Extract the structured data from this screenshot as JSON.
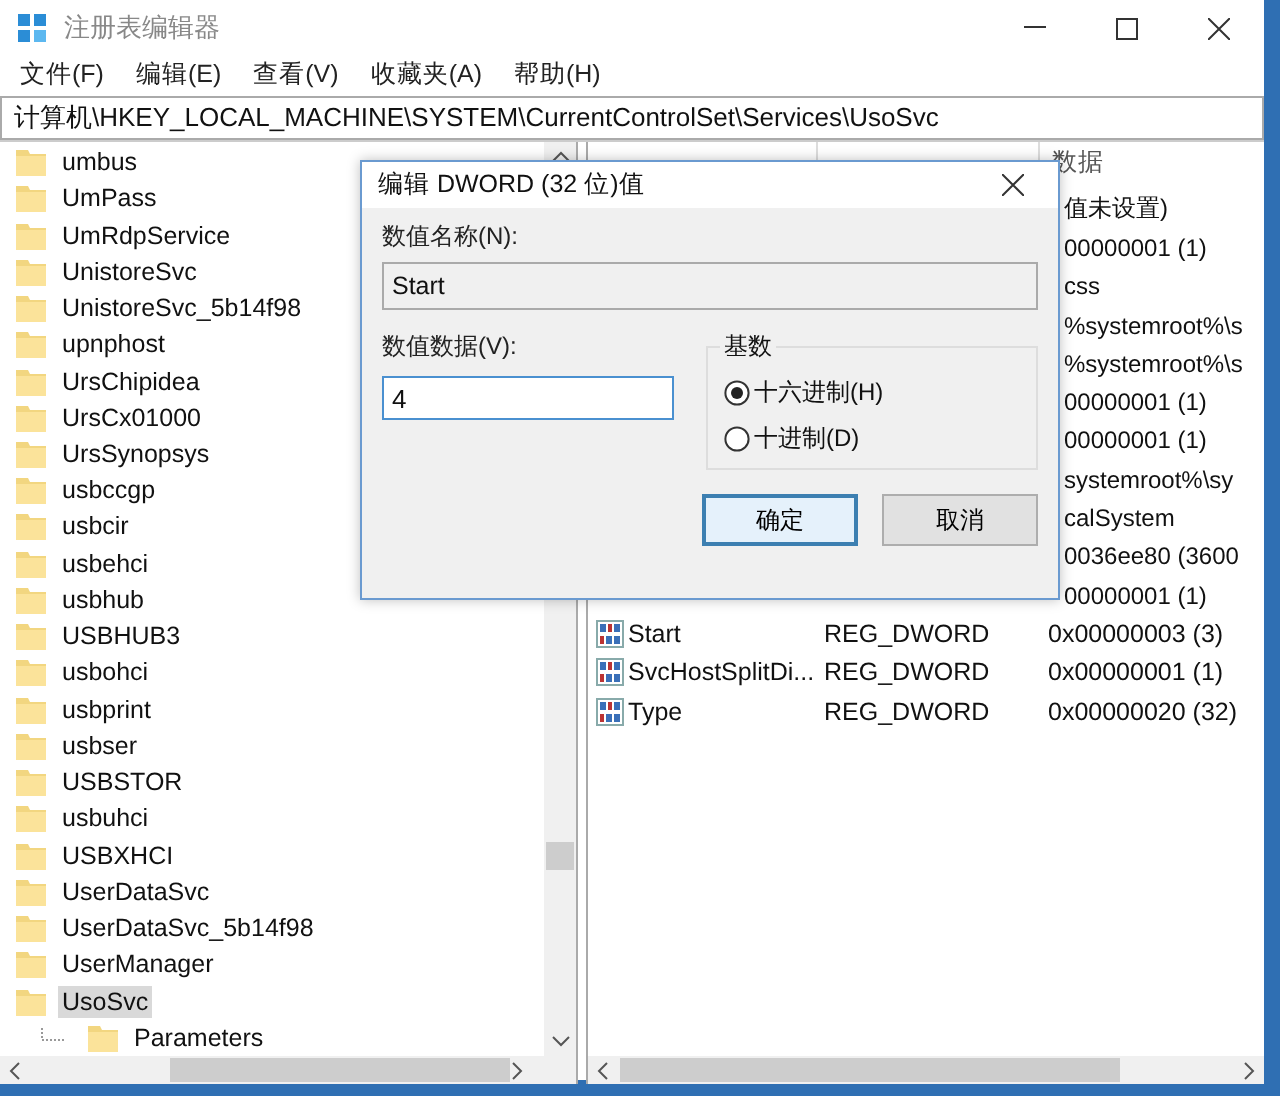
{
  "window": {
    "title": "注册表编辑器"
  },
  "menu": [
    {
      "label": "文件(F)"
    },
    {
      "label": "编辑(E)"
    },
    {
      "label": "查看(V)"
    },
    {
      "label": "收藏夹(A)"
    },
    {
      "label": "帮助(H)"
    }
  ],
  "address": "计算机\\HKEY_LOCAL_MACHINE\\SYSTEM\\CurrentControlSet\\Services\\UsoSvc",
  "tree": [
    {
      "label": "umbus",
      "selected": false
    },
    {
      "label": "UmPass",
      "selected": false
    },
    {
      "label": "UmRdpService",
      "selected": false
    },
    {
      "label": "UnistoreSvc",
      "selected": false
    },
    {
      "label": "UnistoreSvc_5b14f98",
      "selected": false
    },
    {
      "label": "upnphost",
      "selected": false
    },
    {
      "label": "UrsChipidea",
      "selected": false
    },
    {
      "label": "UrsCx01000",
      "selected": false
    },
    {
      "label": "UrsSynopsys",
      "selected": false
    },
    {
      "label": "usbccgp",
      "selected": false
    },
    {
      "label": "usbcir",
      "selected": false
    },
    {
      "label": "usbehci",
      "selected": false
    },
    {
      "label": "usbhub",
      "selected": false
    },
    {
      "label": "USBHUB3",
      "selected": false
    },
    {
      "label": "usbohci",
      "selected": false
    },
    {
      "label": "usbprint",
      "selected": false
    },
    {
      "label": "usbser",
      "selected": false
    },
    {
      "label": "USBSTOR",
      "selected": false
    },
    {
      "label": "usbuhci",
      "selected": false
    },
    {
      "label": "USBXHCI",
      "selected": false
    },
    {
      "label": "UserDataSvc",
      "selected": false
    },
    {
      "label": "UserDataSvc_5b14f98",
      "selected": false
    },
    {
      "label": "UserManager",
      "selected": false
    },
    {
      "label": "UsoSvc",
      "selected": true,
      "children": [
        {
          "label": "Parameters",
          "selected": false
        }
      ]
    }
  ],
  "values": {
    "data_header": "数据",
    "rows": [
      {
        "data": "值未设置)"
      },
      {
        "data": "00000001 (1)"
      },
      {
        "data": "css"
      },
      {
        "data": "%systemroot%\\s"
      },
      {
        "data": "%systemroot%\\s"
      },
      {
        "data": "00000001 (1)"
      },
      {
        "data": "00000001 (1)"
      },
      {
        "data": "systemroot%\\sy"
      },
      {
        "data": "calSystem"
      },
      {
        "data": "0036ee80 (3600"
      },
      {
        "data": "00000001 (1)"
      },
      {
        "name": "Start",
        "type": "REG_DWORD",
        "data": "0x00000003 (3)"
      },
      {
        "name": "SvcHostSplitDi...",
        "type": "REG_DWORD",
        "data": "0x00000001 (1)"
      },
      {
        "name": "Type",
        "type": "REG_DWORD",
        "data": "0x00000020 (32)"
      }
    ]
  },
  "dialog": {
    "title": "编辑 DWORD (32 位)值",
    "name_label": "数值名称(N):",
    "name_value": "Start",
    "data_label": "数值数据(V):",
    "data_value": "4",
    "base_label": "基数",
    "bases": [
      {
        "label": "十六进制(H)",
        "selected": true
      },
      {
        "label": "十进制(D)",
        "selected": false
      }
    ],
    "buttons": [
      {
        "label": "确定",
        "default": true
      },
      {
        "label": "取消",
        "default": false
      }
    ]
  }
}
